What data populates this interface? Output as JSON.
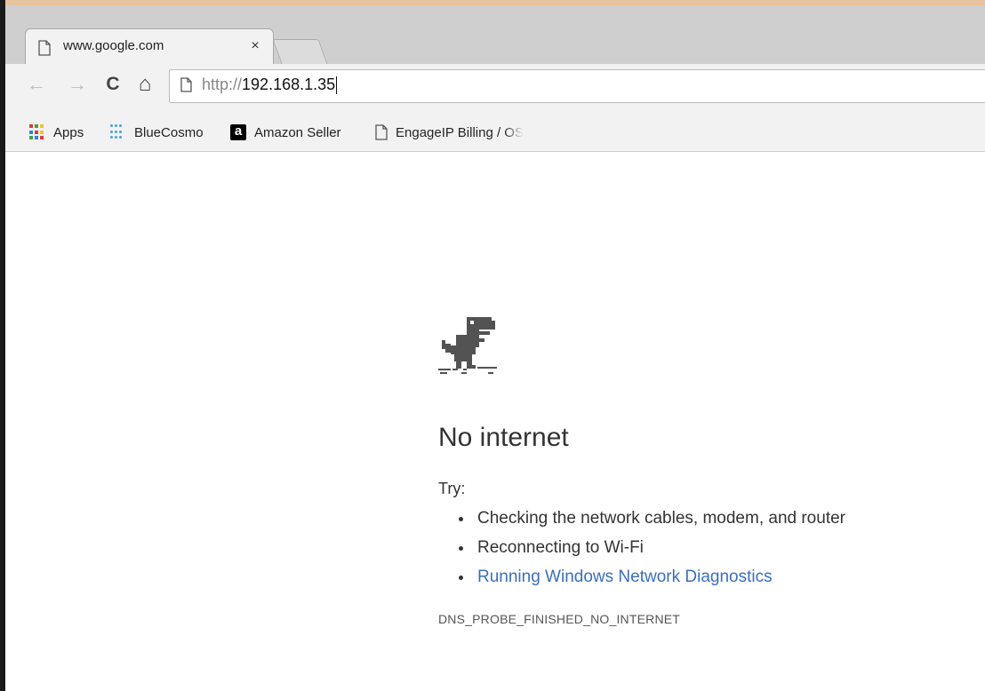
{
  "tab": {
    "title": "www.google.com",
    "close": "×"
  },
  "nav": {
    "back": "←",
    "forward": "→",
    "reload": "C",
    "home": "⌂"
  },
  "omnibox": {
    "scheme": "http://",
    "host": "192.168.1.35"
  },
  "bookmarks": {
    "items": [
      {
        "label": "Apps",
        "icon": "apps-grid-icon"
      },
      {
        "label": "BlueCosmo",
        "icon": "bluecosmo-icon"
      },
      {
        "label": "Amazon Seller",
        "icon": "amazon-icon",
        "icon_text": "a"
      },
      {
        "label": "EngageIP Billing / OS",
        "icon": "page-icon"
      }
    ]
  },
  "error": {
    "title": "No internet",
    "try_label": "Try:",
    "suggestions": [
      "Checking the network cables, modem, and router",
      "Reconnecting to Wi-Fi",
      "Running Windows Network Diagnostics"
    ],
    "code": "DNS_PROBE_FINISHED_NO_INTERNET"
  },
  "colors": {
    "link": "#3a6ec4",
    "apps_grid": [
      "#e53935",
      "#43a047",
      "#fbc02d",
      "#1e88e5",
      "#e53935",
      "#fbc02d",
      "#43a047",
      "#1e88e5",
      "#e53935"
    ]
  }
}
